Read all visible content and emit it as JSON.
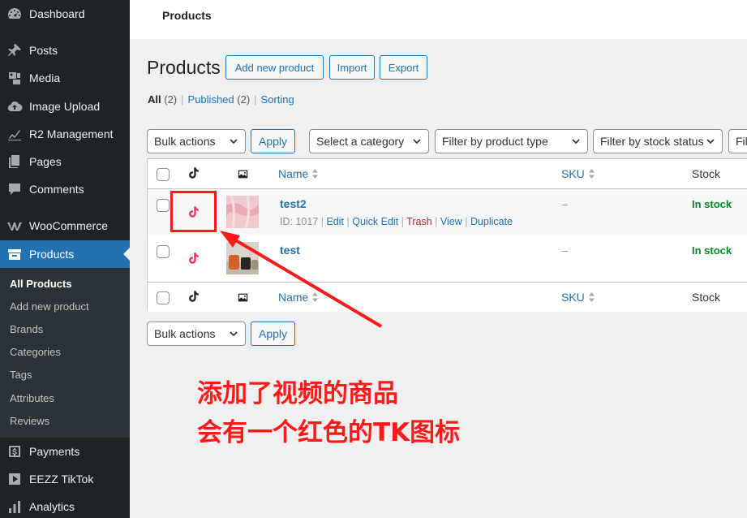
{
  "sidebar": {
    "items": [
      {
        "label": "Dashboard",
        "icon": "dashboard-icon"
      },
      {
        "label": "Posts",
        "icon": "pin-icon"
      },
      {
        "label": "Media",
        "icon": "media-icon"
      },
      {
        "label": "Image Upload",
        "icon": "cloud-icon"
      },
      {
        "label": "R2 Management",
        "icon": "chart-icon"
      },
      {
        "label": "Pages",
        "icon": "pages-icon"
      },
      {
        "label": "Comments",
        "icon": "comment-icon"
      },
      {
        "label": "WooCommerce",
        "icon": "woo-icon"
      },
      {
        "label": "Products",
        "icon": "archive-icon"
      },
      {
        "label": "Payments",
        "icon": "dollar-icon"
      },
      {
        "label": "EEZZ TikTok",
        "icon": "play-icon"
      },
      {
        "label": "Analytics",
        "icon": "bars-icon"
      }
    ],
    "submenu": [
      "All Products",
      "Add new product",
      "Brands",
      "Categories",
      "Tags",
      "Attributes",
      "Reviews"
    ]
  },
  "topbar": {
    "title": "Products"
  },
  "header": {
    "title": "Products",
    "add_new": "Add new product",
    "import": "Import",
    "export": "Export"
  },
  "views": {
    "all": "All",
    "all_count": "(2)",
    "published": "Published",
    "published_count": "(2)",
    "sorting": "Sorting",
    "sep": "|"
  },
  "filters": {
    "bulk": "Bulk actions",
    "apply": "Apply",
    "category": "Select a category",
    "product_type": "Filter by product type",
    "stock_status": "Filter by stock status",
    "cut": "Fil"
  },
  "table": {
    "headers": {
      "name": "Name",
      "sku": "SKU",
      "stock": "Stock"
    },
    "rows": [
      {
        "name": "test2",
        "id_text": "ID: 1017",
        "actions": [
          "Edit",
          "Quick Edit",
          "Trash",
          "View",
          "Duplicate"
        ],
        "sku": "–",
        "stock": "In stock"
      },
      {
        "name": "test",
        "sku": "–",
        "stock": "In stock"
      }
    ]
  },
  "annotation": {
    "line1": "添加了视频的商品",
    "line2": "会有一个红色的TK图标",
    "color": "#ff1a1a"
  },
  "colors": {
    "accent": "#2271b1",
    "sidebar": "#1d2327",
    "instock": "#008a20",
    "tiktok_red": "#fe2c55"
  }
}
